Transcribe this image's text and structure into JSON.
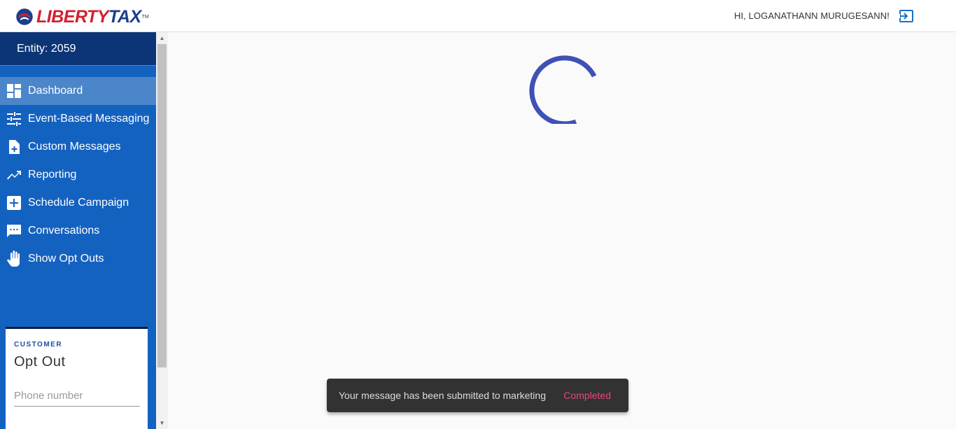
{
  "header": {
    "logo_liberty": "LIBERTY",
    "logo_tax": "TAX",
    "logo_tm": "TM",
    "greeting": "HI, LOGANATHANN MURUGESANN!",
    "logout_icon": "logout-icon"
  },
  "sidebar": {
    "entity": "Entity: 2059",
    "items": [
      {
        "label": "Dashboard",
        "icon": "dashboard-icon",
        "active": true
      },
      {
        "label": "Event-Based Messaging",
        "icon": "sliders-icon"
      },
      {
        "label": "Custom Messages",
        "icon": "file-add-icon"
      },
      {
        "label": "Reporting",
        "icon": "trending-up-icon"
      },
      {
        "label": "Schedule Campaign",
        "icon": "plus-box-icon"
      },
      {
        "label": "Conversations",
        "icon": "chat-icon"
      },
      {
        "label": "Show Opt Outs",
        "icon": "hand-icon"
      }
    ]
  },
  "optout": {
    "kicker": "CUSTOMER",
    "title": "Opt Out",
    "phone_placeholder": "Phone number"
  },
  "snackbar": {
    "message": "Your message has been submitted to marketing",
    "action": "Completed"
  },
  "colors": {
    "sidebar": "#1462c0",
    "entity_bar": "#0c3577",
    "active_item": "#4a86c9",
    "spinner": "#3f51b5",
    "snack_action": "#e8467c"
  }
}
